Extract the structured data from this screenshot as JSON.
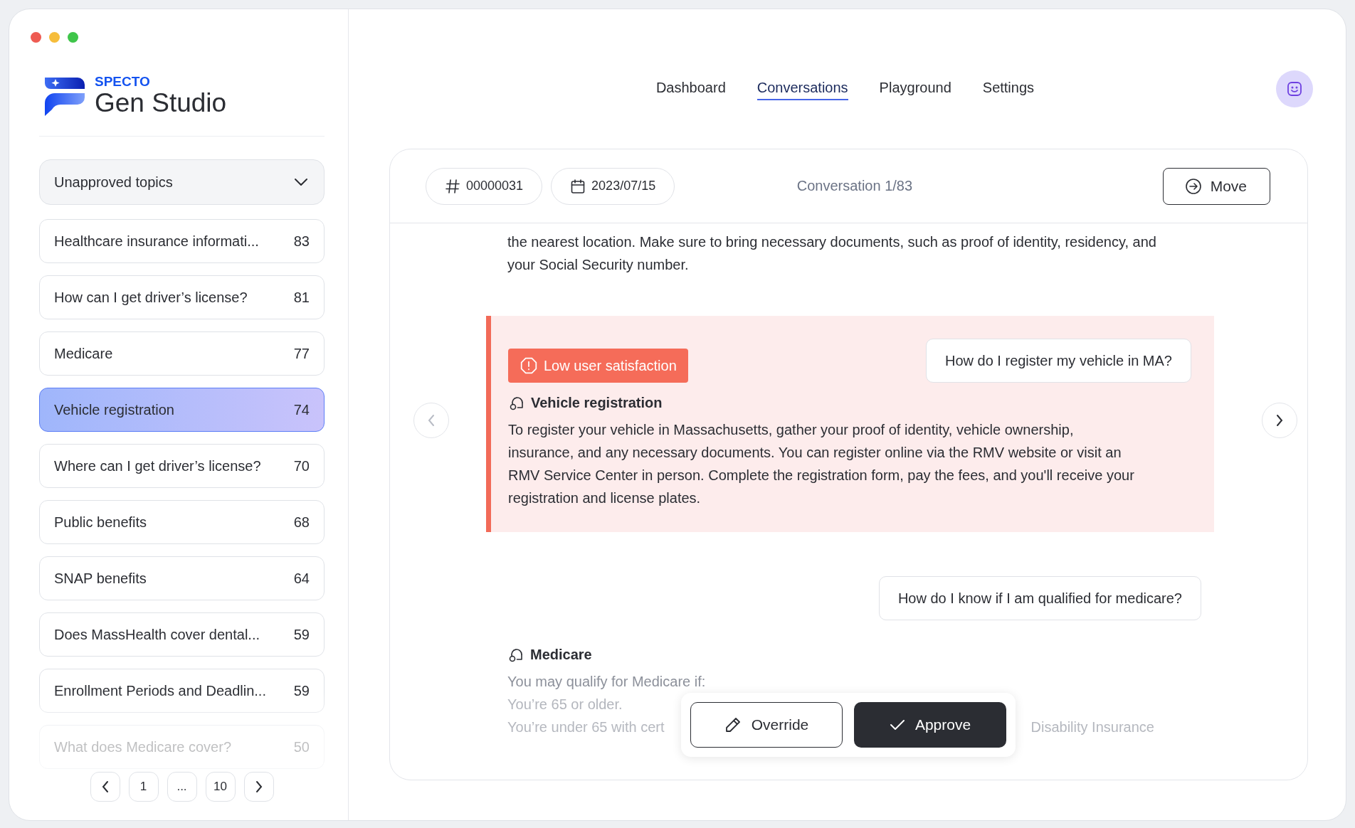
{
  "brand": {
    "company": "SPECTO",
    "product": "Gen Studio"
  },
  "nav": {
    "tabs": [
      {
        "label": "Dashboard",
        "selected": false
      },
      {
        "label": "Conversations",
        "selected": true
      },
      {
        "label": "Playground",
        "selected": false
      },
      {
        "label": "Settings",
        "selected": false
      }
    ]
  },
  "sidebar": {
    "filter": "Unapproved topics",
    "topics": [
      {
        "label": "Healthcare insurance informati...",
        "count": "83",
        "selected": false
      },
      {
        "label": "How can I get driver’s license?",
        "count": "81",
        "selected": false
      },
      {
        "label": "Medicare",
        "count": "77",
        "selected": false
      },
      {
        "label": "Vehicle registration",
        "count": "74",
        "selected": true
      },
      {
        "label": "Where can I get driver’s license?",
        "count": "70",
        "selected": false
      },
      {
        "label": "Public benefits",
        "count": "68",
        "selected": false
      },
      {
        "label": "SNAP benefits",
        "count": "64",
        "selected": false
      },
      {
        "label": "Does MassHealth cover dental...",
        "count": "59",
        "selected": false
      },
      {
        "label": "Enrollment Periods and Deadlin...",
        "count": "59",
        "selected": false
      },
      {
        "label": "What does Medicare cover?",
        "count": "50",
        "selected": false
      }
    ],
    "pages": [
      "1",
      "...",
      "10"
    ]
  },
  "conversation": {
    "id": "00000031",
    "date": "2023/07/15",
    "counter": "Conversation 1/83",
    "move": "Move",
    "messages": [
      {
        "kind": "answer_text",
        "text": "the nearest location. Make sure to bring necessary documents, such as proof of identity, residency, and your Social Security number."
      },
      {
        "kind": "flagged",
        "alert": "Low user satisfaction",
        "question": "How do I register my vehicle in MA?",
        "topic": "Vehicle registration",
        "text": "To register your vehicle in Massachusetts, gather your proof of identity, vehicle ownership, insurance, and any necessary documents. You can register online via the RMV website or visit an RMV Service Center in person. Complete the registration form, pay the fees, and you'll receive your registration and license plates."
      },
      {
        "kind": "question",
        "text": "How do I know if I am qualified for medicare?"
      },
      {
        "kind": "answer",
        "topic": "Medicare",
        "lines": [
          [
            "You may qualify for Medicare if:"
          ],
          [
            "You’re 65 or older."
          ],
          [
            "You’re under 65 with cert",
            "Disability Insurance"
          ]
        ]
      }
    ],
    "actions": [
      {
        "kind": "override",
        "label": "Override"
      },
      {
        "kind": "approve",
        "label": "Approve"
      }
    ]
  }
}
